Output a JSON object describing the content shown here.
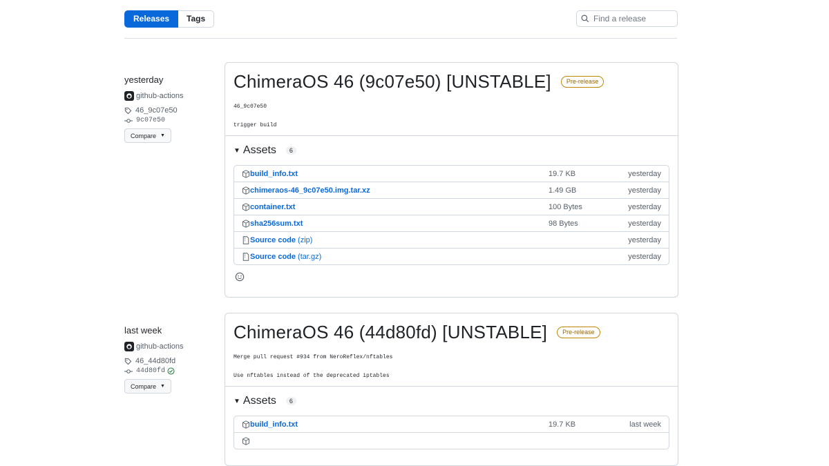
{
  "subnav": {
    "releases": "Releases",
    "tags": "Tags"
  },
  "search": {
    "placeholder": "Find a release"
  },
  "releases": [
    {
      "when": "yesterday",
      "author": "github-actions",
      "tag": "46_9c07e50",
      "commit": "9c07e50",
      "compare": "Compare",
      "title": "ChimeraOS 46 (9c07e50) [UNSTABLE]",
      "badge": "Pre-release",
      "body": [
        "46_9c07e50",
        "trigger build"
      ],
      "assets_label": "Assets",
      "assets_count": "6",
      "assets": [
        {
          "icon": "package-icon",
          "name": "build_info.txt",
          "size": "19.7 KB",
          "date": "yesterday"
        },
        {
          "icon": "package-icon",
          "name": "chimeraos-46_9c07e50.img.tar.xz",
          "size": "1.49 GB",
          "date": "yesterday"
        },
        {
          "icon": "package-icon",
          "name": "container.txt",
          "size": "100 Bytes",
          "date": "yesterday"
        },
        {
          "icon": "package-icon",
          "name": "sha256sum.txt",
          "size": "98 Bytes",
          "date": "yesterday"
        },
        {
          "icon": "file-zip-icon",
          "name": "Source code",
          "suffix": "(zip)",
          "date": "yesterday"
        },
        {
          "icon": "file-zip-icon",
          "name": "Source code",
          "suffix": "(tar.gz)",
          "date": "yesterday"
        }
      ]
    },
    {
      "when": "last week",
      "author": "github-actions",
      "tag": "46_44d80fd",
      "commit": "44d80fd",
      "compare": "Compare",
      "title": "ChimeraOS 46 (44d80fd) [UNSTABLE]",
      "badge": "Pre-release",
      "body": [
        "Merge pull request #934 from NeroReflex/nftables",
        "Use nftables instead of the deprecated iptables"
      ],
      "assets_label": "Assets",
      "assets_count": "6",
      "assets": [
        {
          "icon": "package-icon",
          "name": "build_info.txt",
          "size": "19.7 KB",
          "date": "last week"
        }
      ]
    }
  ],
  "colors": {
    "accent": "#0969da",
    "badge": "#9a6700",
    "verified": "#1a7f37"
  }
}
